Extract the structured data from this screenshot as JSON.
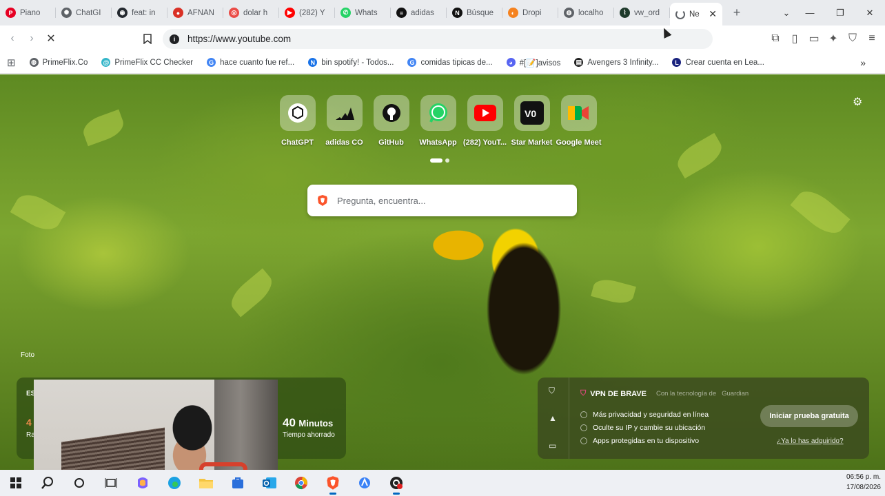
{
  "tabs": [
    {
      "title": "Piano",
      "icon": "pinterest-icon",
      "color": "#e60023"
    },
    {
      "title": "ChatGI",
      "icon": "chatgpt-icon",
      "color": "#5f6368"
    },
    {
      "title": "feat: in",
      "icon": "github-icon",
      "color": "#24292f"
    },
    {
      "title": "AFNAN",
      "icon": "record-icon",
      "color": "#d93025"
    },
    {
      "title": "dolar h",
      "icon": "target-icon",
      "color": "#ea4c47"
    },
    {
      "title": "(282) Y",
      "icon": "youtube-icon",
      "color": "#ff0000"
    },
    {
      "title": "Whats",
      "icon": "whatsapp-icon",
      "color": "#25d366"
    },
    {
      "title": "adidas",
      "icon": "adidas-icon",
      "color": "#111111"
    },
    {
      "title": "Búsque",
      "icon": "notion-icon",
      "color": "#111111"
    },
    {
      "title": "Dropi",
      "icon": "dropi-icon",
      "color": "#f5821f"
    },
    {
      "title": "localho",
      "icon": "globe-icon",
      "color": "#5f6368"
    },
    {
      "title": "vw_ord",
      "icon": "chart-icon",
      "color": "#1f3b2c"
    }
  ],
  "active_tab": {
    "title": "Ne"
  },
  "address": {
    "url": "https://www.youtube.com"
  },
  "bookmarks": [
    {
      "label": "PrimeFlix.Co",
      "icon": "globe-icon",
      "color": "#5f6368"
    },
    {
      "label": "PrimeFlix CC Checker",
      "icon": "spiral-icon",
      "color": "#35b6c9"
    },
    {
      "label": "hace cuanto fue ref...",
      "icon": "google-icon",
      "color": "#4285f4"
    },
    {
      "label": "bin spotify! - Todos...",
      "icon": "n-icon",
      "color": "#1a73e8"
    },
    {
      "label": "comidas tipicas de...",
      "icon": "google-icon",
      "color": "#4285f4"
    },
    {
      "label": "#[📝]avisos",
      "icon": "discord-icon",
      "color": "#5865f2"
    },
    {
      "label": "Avengers 3 Infinity...",
      "icon": "film-icon",
      "color": "#222222"
    },
    {
      "label": "Crear cuenta en Lea...",
      "icon": "lea-icon",
      "color": "#1a237e"
    }
  ],
  "shortcuts": [
    {
      "label": "ChatGPT",
      "icon": "chatgpt-icon"
    },
    {
      "label": "adidas CO",
      "icon": "adidas-icon"
    },
    {
      "label": "GitHub",
      "icon": "github-icon"
    },
    {
      "label": "WhatsApp",
      "icon": "whatsapp-icon"
    },
    {
      "label": "(282) YouT...",
      "icon": "youtube-icon"
    },
    {
      "label": "Star Market",
      "icon": "star-market-icon"
    },
    {
      "label": "Google Meet",
      "icon": "google-meet-icon"
    }
  ],
  "search": {
    "placeholder": "Pregunta, encuentra..."
  },
  "photo_credit": "Foto",
  "stats": {
    "heading": "ES",
    "value": "4",
    "value_label": "Ra",
    "minutes_value": "40",
    "minutes_unit": "Minutos",
    "minutes_label": "Tiempo ahorrado"
  },
  "vpn": {
    "title": "VPN DE BRAVE",
    "powered_by": "Con la tecnología de",
    "powered_name": "Guardian",
    "features": [
      "Más privacidad y seguridad en línea",
      "Oculte su IP y cambie su ubicación",
      "Apps protegidas en tu dispositivo"
    ],
    "cta": "Iniciar prueba gratuita",
    "have_it": "¿Ya lo has adquirido?"
  },
  "clock": {
    "time": "06:56 p. m.",
    "date": "17/08/2026"
  },
  "colors": {
    "accent_brave": "#fb542b",
    "search_text": "#6b6f74"
  }
}
